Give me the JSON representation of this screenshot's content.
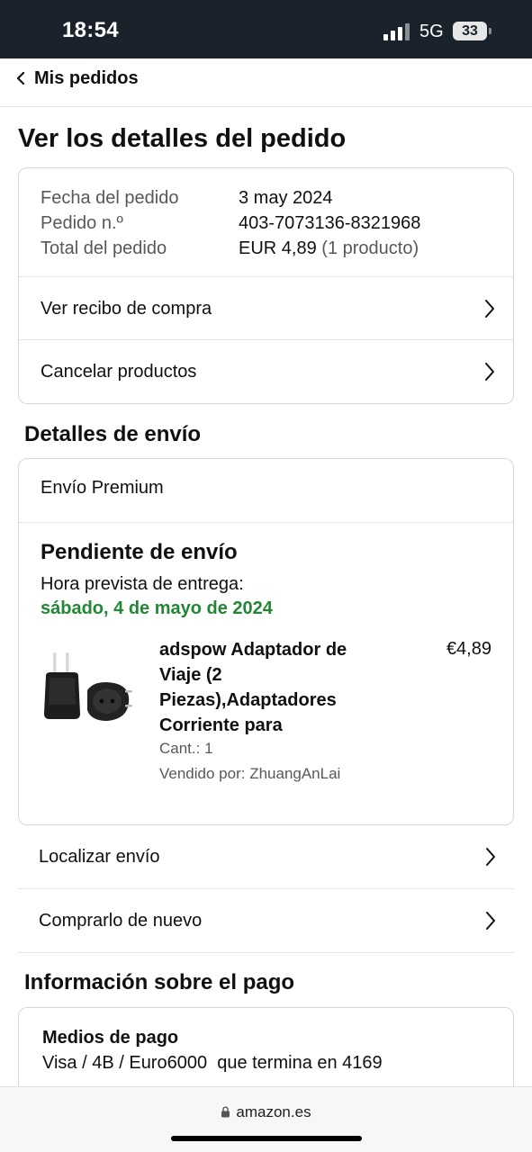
{
  "status_bar": {
    "time": "18:54",
    "network": "5G",
    "battery": "33"
  },
  "nav": {
    "back_label": "Mis pedidos"
  },
  "page_title": "Ver los detalles del pedido",
  "order_summary": {
    "date_label": "Fecha del pedido",
    "date_value": "3 may 2024",
    "number_label": "Pedido n.º",
    "number_value": "403-7073136-8321968",
    "total_label": "Total del pedido",
    "total_value": "EUR 4,89",
    "total_count": "(1 producto)"
  },
  "order_actions": {
    "receipt_label": "Ver recibo de compra",
    "cancel_label": "Cancelar productos"
  },
  "shipping": {
    "section_title": "Detalles de envío",
    "method": "Envío Premium",
    "status": "Pendiente de envío",
    "eta_label": "Hora prevista de entrega:",
    "eta_date": "sábado, 4 de mayo de 2024",
    "accent_color": "#218735"
  },
  "product": {
    "title": "adspow Adaptador de Viaje (2 Piezas),Adaptadores Corriente para",
    "price": "€4,89",
    "quantity": "Cant.: 1",
    "seller": "Vendido por: ZhuangAnLai",
    "image_icon": "travel-adapter-image"
  },
  "shipment_actions": {
    "track_label": "Localizar envío",
    "buy_again_label": "Comprarlo de nuevo"
  },
  "payment": {
    "section_title": "Información sobre el pago",
    "methods_title": "Medios de pago",
    "methods_value": "Visa / 4B / Euro6000  que termina en 4169"
  },
  "browser": {
    "url": "amazon.es"
  }
}
